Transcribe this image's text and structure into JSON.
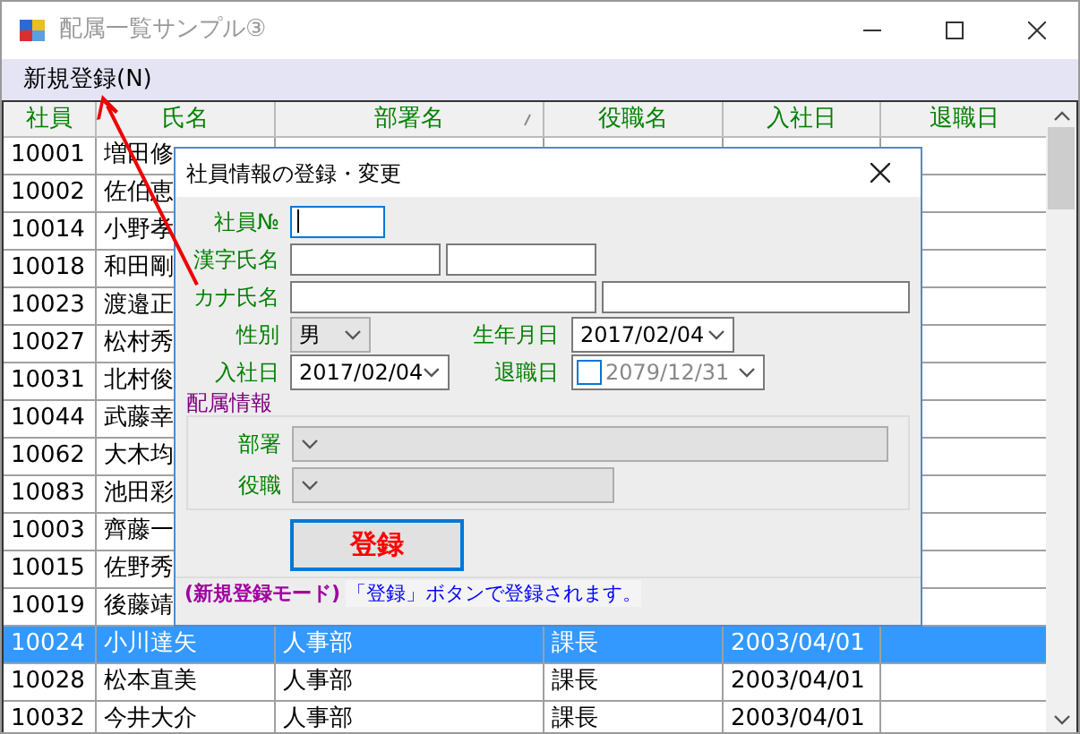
{
  "window": {
    "title": "配属一覧サンプル③"
  },
  "menu": [
    {
      "label": "新規登録(N)"
    }
  ],
  "table": {
    "columns": [
      {
        "label": "社員",
        "sorted": false
      },
      {
        "label": "氏名",
        "sorted": false
      },
      {
        "label": "部署名",
        "sorted": true
      },
      {
        "label": "役職名",
        "sorted": false
      },
      {
        "label": "入社日",
        "sorted": false
      },
      {
        "label": "退職日",
        "sorted": false
      }
    ],
    "rows": [
      {
        "cells": [
          "10001",
          "増田修"
        ],
        "selected": false
      },
      {
        "cells": [
          "10002",
          "佐伯恵"
        ],
        "selected": false
      },
      {
        "cells": [
          "10014",
          "小野孝"
        ],
        "selected": false
      },
      {
        "cells": [
          "10018",
          "和田剛"
        ],
        "selected": false
      },
      {
        "cells": [
          "10023",
          "渡邉正"
        ],
        "selected": false
      },
      {
        "cells": [
          "10027",
          "松村秀"
        ],
        "selected": false
      },
      {
        "cells": [
          "10031",
          "北村俊"
        ],
        "selected": false
      },
      {
        "cells": [
          "10044",
          "武藤幸"
        ],
        "selected": false
      },
      {
        "cells": [
          "10062",
          "大木均"
        ],
        "selected": false
      },
      {
        "cells": [
          "10083",
          "池田彩"
        ],
        "selected": false
      },
      {
        "cells": [
          "10003",
          "齊藤一"
        ],
        "selected": false
      },
      {
        "cells": [
          "10015",
          "佐野秀"
        ],
        "selected": false
      },
      {
        "cells": [
          "10019",
          "後藤靖"
        ],
        "selected": false
      },
      {
        "cells": [
          "10024",
          "小川達矢",
          "人事部",
          "課長",
          "2003/04/01"
        ],
        "selected": true
      },
      {
        "cells": [
          "10028",
          "松本直美",
          "人事部",
          "課長",
          "2003/04/01"
        ],
        "selected": false
      },
      {
        "cells": [
          "10032",
          "今井大介",
          "人事部",
          "課長",
          "2003/04/01"
        ],
        "selected": false
      }
    ]
  },
  "dialog": {
    "title": "社員情報の登録・変更",
    "employee_no": {
      "label": "社員№",
      "focused": true
    },
    "kanji_name": {
      "label": "漢字氏名"
    },
    "kana_name": {
      "label": "カナ氏名"
    },
    "gender": {
      "label": "性別",
      "value": "男"
    },
    "birth_date": {
      "label": "生年月日",
      "value": "2017/02/04"
    },
    "hire_date": {
      "label": "入社日",
      "value": "2017/02/04"
    },
    "retire_date": {
      "label": "退職日",
      "value": "2079/12/31",
      "checked": false
    },
    "assignment": {
      "title": "配属情報",
      "department": {
        "label": "部署",
        "disabled": true
      },
      "position": {
        "label": "役職",
        "disabled": true
      }
    },
    "submit": {
      "label": "登録"
    },
    "status": {
      "mode": "(新規登録モード)",
      "message": "「登録」ボタンで登録されます。"
    }
  }
}
